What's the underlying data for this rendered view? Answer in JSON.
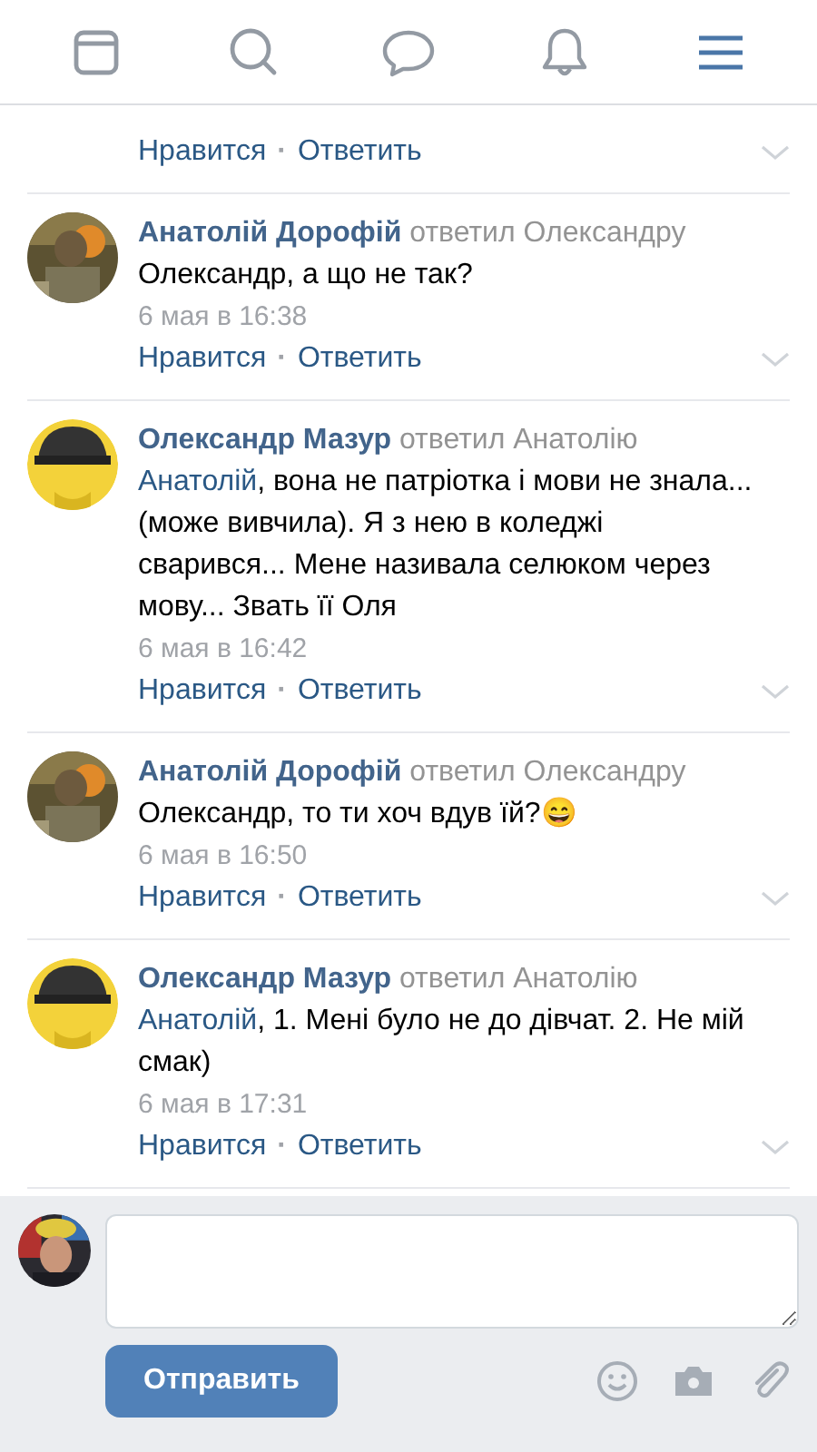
{
  "header": {
    "tabs": [
      {
        "kind": "feed",
        "selected": false
      },
      {
        "kind": "search",
        "selected": false
      },
      {
        "kind": "messages",
        "selected": false
      },
      {
        "kind": "notifications",
        "selected": false
      },
      {
        "kind": "menu",
        "selected": true
      }
    ]
  },
  "comments": [
    {
      "like": "Нравится",
      "separator": "·",
      "reply": "Ответить"
    },
    {
      "author": "Анатолій Дорофій",
      "replied_to": "ответил Олександру",
      "text": "Олександр, а що не так?",
      "time": "6 мая в 16:38",
      "like": "Нравится",
      "separator": "·",
      "reply": "Ответить"
    },
    {
      "author": "Олександр Мазур",
      "replied_to": "ответил Анатолію",
      "mention": "Анатолій",
      "text": ", вона не патріотка і мови не знала... (може вивчила). Я з нею в коледжі сварився... Мене називала селюком через мову... Звать її Оля",
      "time": "6 мая в 16:42",
      "like": "Нравится",
      "separator": "·",
      "reply": "Ответить"
    },
    {
      "author": "Анатолій Дорофій",
      "replied_to": "ответил Олександру",
      "text": "Олександр, то ти хоч вдув їй?😄",
      "time": "6 мая в 16:50",
      "like": "Нравится",
      "separator": "·",
      "reply": "Ответить"
    },
    {
      "author": "Олександр Мазур",
      "replied_to": "ответил Анатолію",
      "mention": "Анатолій",
      "text": ", 1. Мені було не до дівчат. 2. Не мій смак)",
      "time": "6 мая в 17:31",
      "like": "Нравится",
      "separator": "·",
      "reply": "Ответить"
    }
  ],
  "composer": {
    "send_button": "Отправить"
  }
}
